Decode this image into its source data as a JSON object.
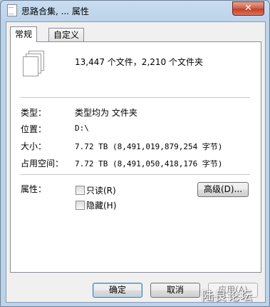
{
  "window": {
    "title": "思路合集, ... 属性",
    "close_label": "✕"
  },
  "tabs": [
    {
      "label": "常规"
    },
    {
      "label": "自定义"
    }
  ],
  "general": {
    "count_text": "13,447 个文件，2,210 个文件夹",
    "type_label": "类型：",
    "type_value": "类型均为 文件夹",
    "location_label": "位置：",
    "location_value": "D:\\",
    "size_label": "大小：",
    "size_value": "7.72 TB (8,491,019,879,254 字节)",
    "size_on_disk_label": "占用空间：",
    "size_on_disk_value": "7.72 TB (8,491,050,418,176 字节)",
    "attributes_label": "属性：",
    "readonly_label": "只读(R)",
    "hidden_label": "隐藏(H)",
    "advanced_button": "高级(D)..."
  },
  "buttons": {
    "ok": "确定",
    "cancel": "取消",
    "apply": "应用(A)"
  },
  "watermark": "陆良论坛"
}
